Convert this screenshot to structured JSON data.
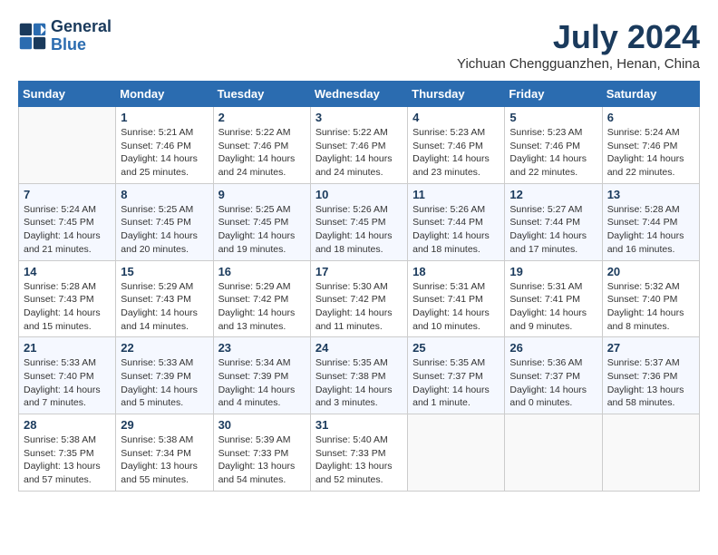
{
  "header": {
    "logo_line1": "General",
    "logo_line2": "Blue",
    "month": "July 2024",
    "location": "Yichuan Chengguanzhen, Henan, China"
  },
  "days_of_week": [
    "Sunday",
    "Monday",
    "Tuesday",
    "Wednesday",
    "Thursday",
    "Friday",
    "Saturday"
  ],
  "weeks": [
    [
      {
        "day": "",
        "info": ""
      },
      {
        "day": "1",
        "info": "Sunrise: 5:21 AM\nSunset: 7:46 PM\nDaylight: 14 hours\nand 25 minutes."
      },
      {
        "day": "2",
        "info": "Sunrise: 5:22 AM\nSunset: 7:46 PM\nDaylight: 14 hours\nand 24 minutes."
      },
      {
        "day": "3",
        "info": "Sunrise: 5:22 AM\nSunset: 7:46 PM\nDaylight: 14 hours\nand 24 minutes."
      },
      {
        "day": "4",
        "info": "Sunrise: 5:23 AM\nSunset: 7:46 PM\nDaylight: 14 hours\nand 23 minutes."
      },
      {
        "day": "5",
        "info": "Sunrise: 5:23 AM\nSunset: 7:46 PM\nDaylight: 14 hours\nand 22 minutes."
      },
      {
        "day": "6",
        "info": "Sunrise: 5:24 AM\nSunset: 7:46 PM\nDaylight: 14 hours\nand 22 minutes."
      }
    ],
    [
      {
        "day": "7",
        "info": "Sunrise: 5:24 AM\nSunset: 7:45 PM\nDaylight: 14 hours\nand 21 minutes."
      },
      {
        "day": "8",
        "info": "Sunrise: 5:25 AM\nSunset: 7:45 PM\nDaylight: 14 hours\nand 20 minutes."
      },
      {
        "day": "9",
        "info": "Sunrise: 5:25 AM\nSunset: 7:45 PM\nDaylight: 14 hours\nand 19 minutes."
      },
      {
        "day": "10",
        "info": "Sunrise: 5:26 AM\nSunset: 7:45 PM\nDaylight: 14 hours\nand 18 minutes."
      },
      {
        "day": "11",
        "info": "Sunrise: 5:26 AM\nSunset: 7:44 PM\nDaylight: 14 hours\nand 18 minutes."
      },
      {
        "day": "12",
        "info": "Sunrise: 5:27 AM\nSunset: 7:44 PM\nDaylight: 14 hours\nand 17 minutes."
      },
      {
        "day": "13",
        "info": "Sunrise: 5:28 AM\nSunset: 7:44 PM\nDaylight: 14 hours\nand 16 minutes."
      }
    ],
    [
      {
        "day": "14",
        "info": "Sunrise: 5:28 AM\nSunset: 7:43 PM\nDaylight: 14 hours\nand 15 minutes."
      },
      {
        "day": "15",
        "info": "Sunrise: 5:29 AM\nSunset: 7:43 PM\nDaylight: 14 hours\nand 14 minutes."
      },
      {
        "day": "16",
        "info": "Sunrise: 5:29 AM\nSunset: 7:42 PM\nDaylight: 14 hours\nand 13 minutes."
      },
      {
        "day": "17",
        "info": "Sunrise: 5:30 AM\nSunset: 7:42 PM\nDaylight: 14 hours\nand 11 minutes."
      },
      {
        "day": "18",
        "info": "Sunrise: 5:31 AM\nSunset: 7:41 PM\nDaylight: 14 hours\nand 10 minutes."
      },
      {
        "day": "19",
        "info": "Sunrise: 5:31 AM\nSunset: 7:41 PM\nDaylight: 14 hours\nand 9 minutes."
      },
      {
        "day": "20",
        "info": "Sunrise: 5:32 AM\nSunset: 7:40 PM\nDaylight: 14 hours\nand 8 minutes."
      }
    ],
    [
      {
        "day": "21",
        "info": "Sunrise: 5:33 AM\nSunset: 7:40 PM\nDaylight: 14 hours\nand 7 minutes."
      },
      {
        "day": "22",
        "info": "Sunrise: 5:33 AM\nSunset: 7:39 PM\nDaylight: 14 hours\nand 5 minutes."
      },
      {
        "day": "23",
        "info": "Sunrise: 5:34 AM\nSunset: 7:39 PM\nDaylight: 14 hours\nand 4 minutes."
      },
      {
        "day": "24",
        "info": "Sunrise: 5:35 AM\nSunset: 7:38 PM\nDaylight: 14 hours\nand 3 minutes."
      },
      {
        "day": "25",
        "info": "Sunrise: 5:35 AM\nSunset: 7:37 PM\nDaylight: 14 hours\nand 1 minute."
      },
      {
        "day": "26",
        "info": "Sunrise: 5:36 AM\nSunset: 7:37 PM\nDaylight: 14 hours\nand 0 minutes."
      },
      {
        "day": "27",
        "info": "Sunrise: 5:37 AM\nSunset: 7:36 PM\nDaylight: 13 hours\nand 58 minutes."
      }
    ],
    [
      {
        "day": "28",
        "info": "Sunrise: 5:38 AM\nSunset: 7:35 PM\nDaylight: 13 hours\nand 57 minutes."
      },
      {
        "day": "29",
        "info": "Sunrise: 5:38 AM\nSunset: 7:34 PM\nDaylight: 13 hours\nand 55 minutes."
      },
      {
        "day": "30",
        "info": "Sunrise: 5:39 AM\nSunset: 7:33 PM\nDaylight: 13 hours\nand 54 minutes."
      },
      {
        "day": "31",
        "info": "Sunrise: 5:40 AM\nSunset: 7:33 PM\nDaylight: 13 hours\nand 52 minutes."
      },
      {
        "day": "",
        "info": ""
      },
      {
        "day": "",
        "info": ""
      },
      {
        "day": "",
        "info": ""
      }
    ]
  ]
}
